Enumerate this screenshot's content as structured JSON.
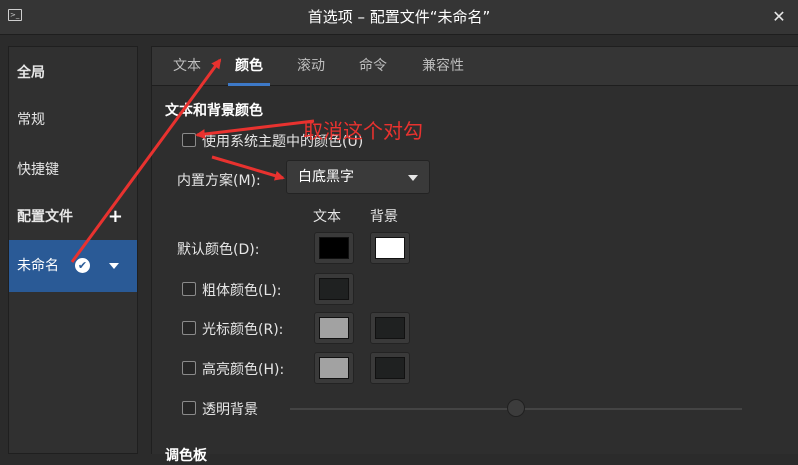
{
  "window": {
    "title": "首选项 – 配置文件“未命名”",
    "app_icon_glyph": ">_",
    "close_glyph": "✕"
  },
  "sidebar": {
    "global_label": "全局",
    "general_label": "常规",
    "shortcuts_label": "快捷键",
    "profiles_label": "配置文件",
    "add_profile_glyph": "+",
    "selected_profile": {
      "name": "未命名",
      "default_check_glyph": "✔"
    },
    "selected_bg": "#2a5a96"
  },
  "tabs": [
    "文本",
    "颜色",
    "滚动",
    "命令",
    "兼容性"
  ],
  "active_tab": "颜色",
  "colors_tab": {
    "section_title": "文本和背景颜色",
    "use_system_theme": {
      "label": "使用系统主题中的颜色(U)",
      "checked": false
    },
    "builtin_scheme": {
      "label": "内置方案(M):",
      "value": "白底黑字"
    },
    "column_headers": {
      "text": "文本",
      "background": "背景"
    },
    "rows": {
      "default": {
        "label": "默认颜色(D):",
        "text_color": "#000000",
        "bg_color": "#ffffff"
      },
      "bold": {
        "label": "粗体颜色(L):",
        "checked": false,
        "text_color": "#1f2121"
      },
      "cursor": {
        "label": "光标颜色(R):",
        "checked": false,
        "text_color": "#a2a2a2",
        "bg_color": "#1f2121"
      },
      "highlight": {
        "label": "高亮颜色(H):",
        "checked": false,
        "text_color": "#a2a2a2",
        "bg_color": "#1f2121"
      }
    },
    "transparent_bg": {
      "label": "透明背景",
      "checked": false,
      "slider_level": 0.5
    },
    "palette_title": "调色板"
  },
  "annotation": {
    "text": "取消这个对勾",
    "color": "#e8322f"
  }
}
